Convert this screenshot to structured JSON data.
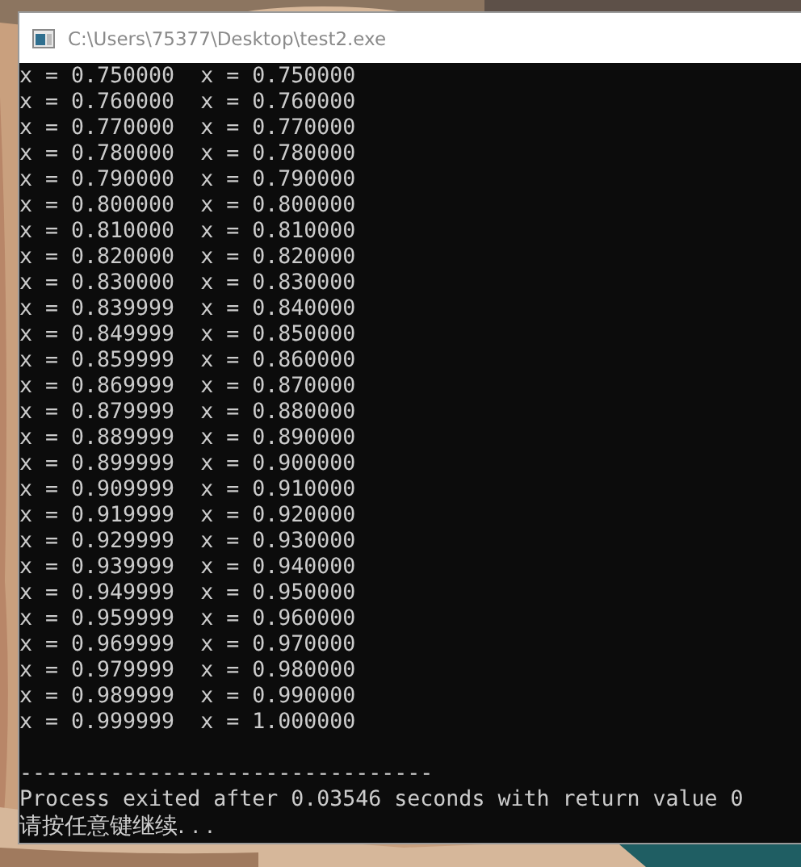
{
  "window": {
    "title": "C:\\Users\\75377\\Desktop\\test2.exe"
  },
  "console": {
    "lines": [
      "x = 0.750000  x = 0.750000",
      "x = 0.760000  x = 0.760000",
      "x = 0.770000  x = 0.770000",
      "x = 0.780000  x = 0.780000",
      "x = 0.790000  x = 0.790000",
      "x = 0.800000  x = 0.800000",
      "x = 0.810000  x = 0.810000",
      "x = 0.820000  x = 0.820000",
      "x = 0.830000  x = 0.830000",
      "x = 0.839999  x = 0.840000",
      "x = 0.849999  x = 0.850000",
      "x = 0.859999  x = 0.860000",
      "x = 0.869999  x = 0.870000",
      "x = 0.879999  x = 0.880000",
      "x = 0.889999  x = 0.890000",
      "x = 0.899999  x = 0.900000",
      "x = 0.909999  x = 0.910000",
      "x = 0.919999  x = 0.920000",
      "x = 0.929999  x = 0.930000",
      "x = 0.939999  x = 0.940000",
      "x = 0.949999  x = 0.950000",
      "x = 0.959999  x = 0.960000",
      "x = 0.969999  x = 0.970000",
      "x = 0.979999  x = 0.980000",
      "x = 0.989999  x = 0.990000",
      "x = 0.999999  x = 1.000000"
    ],
    "separator": "--------------------------------",
    "exit_message": "Process exited after 0.03546 seconds with return value 0",
    "prompt": "请按任意键继续. . ."
  }
}
